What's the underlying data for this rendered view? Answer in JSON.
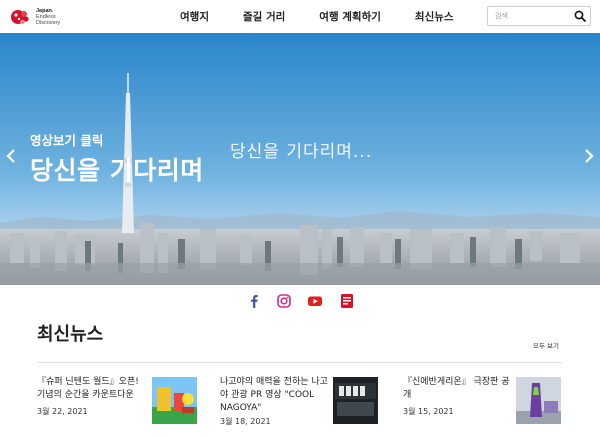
{
  "header": {
    "logo": {
      "line1": "Japan.",
      "line2": "Endless",
      "line3": "Discovery"
    },
    "nav": [
      "여행지",
      "즐길 거리",
      "여행 계획하기",
      "최신뉴스"
    ],
    "search": {
      "placeholder": "검색"
    }
  },
  "hero": {
    "subtitle": "영상보기 클릭",
    "title": "당신을 기다리며",
    "script_text": "당신을 기다리며..."
  },
  "social": [
    "facebook-icon",
    "instagram-icon",
    "youtube-icon",
    "blog-icon"
  ],
  "news": {
    "heading": "최신뉴스",
    "see_all": "모두 보기",
    "items": [
      {
        "title": "『슈퍼 닌텐도 월드』오픈! 기념의 순간을 카운트다운",
        "date": "3월 22, 2021"
      },
      {
        "title": "나고야의 매력을 전하는 나고야 관광 PR 영상 \"COOL NAGOYA\"",
        "date": "3월 18, 2021"
      },
      {
        "title": "『신에반게리온』 극장판 공개",
        "date": "3월 15, 2021"
      }
    ]
  },
  "colors": {
    "brand_red": "#d7102a",
    "facebook": "#3b5998",
    "youtube": "#e0201c",
    "instagram": "#d6287b"
  }
}
